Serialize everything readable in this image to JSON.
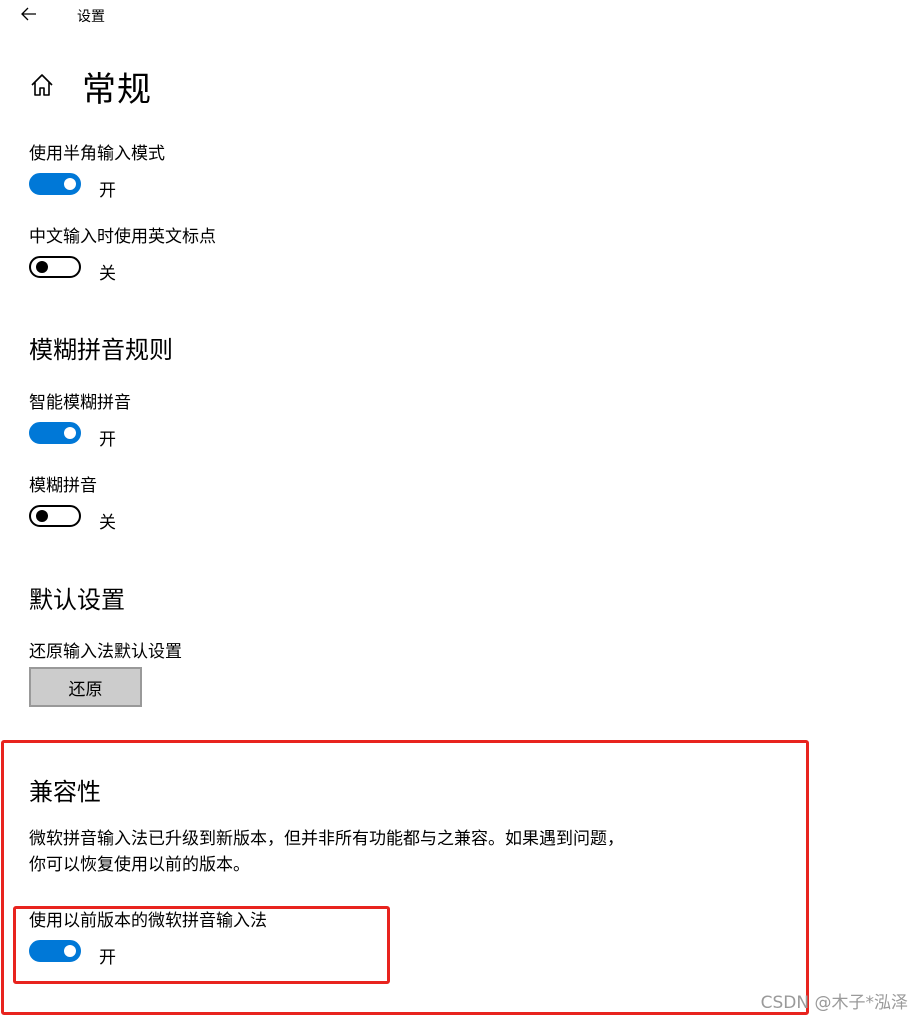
{
  "header": {
    "back_icon": "arrow-left-icon",
    "title": "设置"
  },
  "page": {
    "home_icon": "home-icon",
    "title": "常规"
  },
  "general": {
    "half_width": {
      "label": "使用半角输入模式",
      "state": "开",
      "on": true
    },
    "english_punct": {
      "label": "中文输入时使用英文标点",
      "state": "关",
      "on": false
    }
  },
  "fuzzy": {
    "title": "模糊拼音规则",
    "smart_fuzzy": {
      "label": "智能模糊拼音",
      "state": "开",
      "on": true
    },
    "fuzzy_pinyin": {
      "label": "模糊拼音",
      "state": "关",
      "on": false
    }
  },
  "defaults": {
    "title": "默认设置",
    "restore_label": "还原输入法默认设置",
    "restore_button": "还原"
  },
  "compat": {
    "title": "兼容性",
    "description": "微软拼音输入法已升级到新版本，但并非所有功能都与之兼容。如果遇到问题，你可以恢复使用以前的版本。",
    "previous_version": {
      "label": "使用以前版本的微软拼音输入法",
      "state": "开",
      "on": true
    }
  },
  "annotations": {
    "highlight_color": "#e8231e"
  },
  "watermark": "CSDN @木子*泓泽",
  "colors": {
    "accent": "#0078d7",
    "button_bg": "#cccccc"
  }
}
